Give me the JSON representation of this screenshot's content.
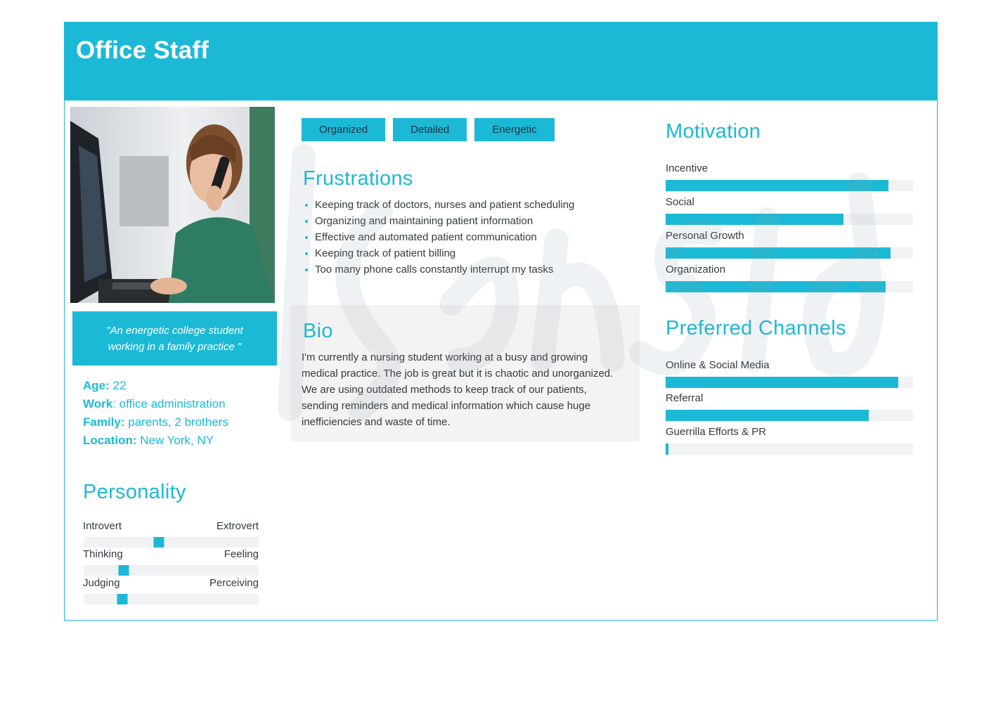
{
  "header": {
    "title": "Office Staff",
    "accent": "#1cb9d6"
  },
  "quote": "\"An energetic college student working in a family practice \"",
  "facts": [
    {
      "key": "Age:",
      "value": " 22"
    },
    {
      "key": "Work",
      "value": ": office administration"
    },
    {
      "key": "Family:",
      "value": " parents, 2 brothers"
    },
    {
      "key": "Location:",
      "value": " New York, NY"
    }
  ],
  "personality": {
    "title": "Personality",
    "scales": [
      {
        "left": "Introvert",
        "right": "Extrovert",
        "position": 0.43
      },
      {
        "left": "Thinking",
        "right": "Feeling",
        "position": 0.23
      },
      {
        "left": "Judging",
        "right": "Perceiving",
        "position": 0.22
      }
    ]
  },
  "tags": [
    "Organized",
    "Detailed",
    "Energetic"
  ],
  "frustrations": {
    "title": "Frustrations",
    "items": [
      "Keeping track of doctors, nurses and patient scheduling",
      "Organizing and maintaining patient information",
      "Effective and automated patient communication",
      "Keeping track of patient billing",
      "Too many phone calls constantly interrupt my tasks"
    ]
  },
  "bio": {
    "title": "Bio",
    "text": "I'm currently a nursing student working at a busy and growing medical practice. The job is great but it is chaotic and unorganized. We are using outdated methods to keep track of our patients, sending reminders and medical information which cause huge inefficiencies and waste of time."
  },
  "motivation": {
    "title": "Motivation",
    "items": [
      {
        "label": "Incentive",
        "value": 0.9
      },
      {
        "label": "Social",
        "value": 0.72
      },
      {
        "label": "Personal Growth",
        "value": 0.91
      },
      {
        "label": "Organization",
        "value": 0.89
      }
    ]
  },
  "channels": {
    "title": "Preferred Channels",
    "items": [
      {
        "label": "Online & Social Media",
        "value": 0.94
      },
      {
        "label": "Referral",
        "value": 0.82
      },
      {
        "label": "Guerrilla Efforts & PR",
        "value": 0.01
      }
    ]
  }
}
